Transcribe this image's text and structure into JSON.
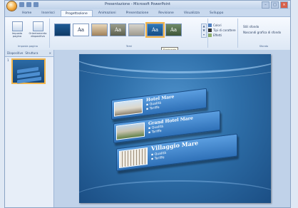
{
  "window": {
    "title": "Presentazione - Microsoft PowerPoint",
    "controls": [
      "–",
      "□",
      "×"
    ]
  },
  "ribbon": {
    "tabs": [
      "Home",
      "Inserisci",
      "Progettazione",
      "Animazioni",
      "Presentazione",
      "Revisione",
      "Visualizza",
      "Sviluppo"
    ],
    "active_tab": "Progettazione",
    "page_setup": {
      "buttons": [
        "Imposta pagina",
        "Orientamento diapositiva"
      ],
      "group_label": "Imposta pagina"
    },
    "themes": {
      "items": [
        "",
        "Aa",
        "",
        "Aa",
        "",
        "Aa",
        "Aa"
      ],
      "selected_index": 5,
      "group_label": "Temi"
    },
    "theme_options": [
      "Colori",
      "Tipi di carattere",
      "Effetti"
    ],
    "background": {
      "options": [
        "Stili sfondo",
        "Nascondi grafica di sfondo"
      ],
      "group_label": "Sfondo"
    },
    "tooltip": "Equinozio"
  },
  "slides_panel": {
    "tabs": [
      "Diapositive",
      "Struttura"
    ],
    "close": "×",
    "slide_number": "1"
  },
  "slide": {
    "panels": [
      {
        "title": "Hotel Mare",
        "bullets": [
          "Qualità",
          "Tariffe"
        ]
      },
      {
        "title": "Grand Hotel Mare",
        "bullets": [
          "Qualità",
          "Tariffe"
        ]
      },
      {
        "title": "Villaggio Mare",
        "bullets": [
          "Qualità",
          "Tariffe"
        ]
      }
    ]
  },
  "colors": {
    "accent": "#f3b54a",
    "slide_bg": "#2e6fa9",
    "panel": "#3f85cc"
  }
}
